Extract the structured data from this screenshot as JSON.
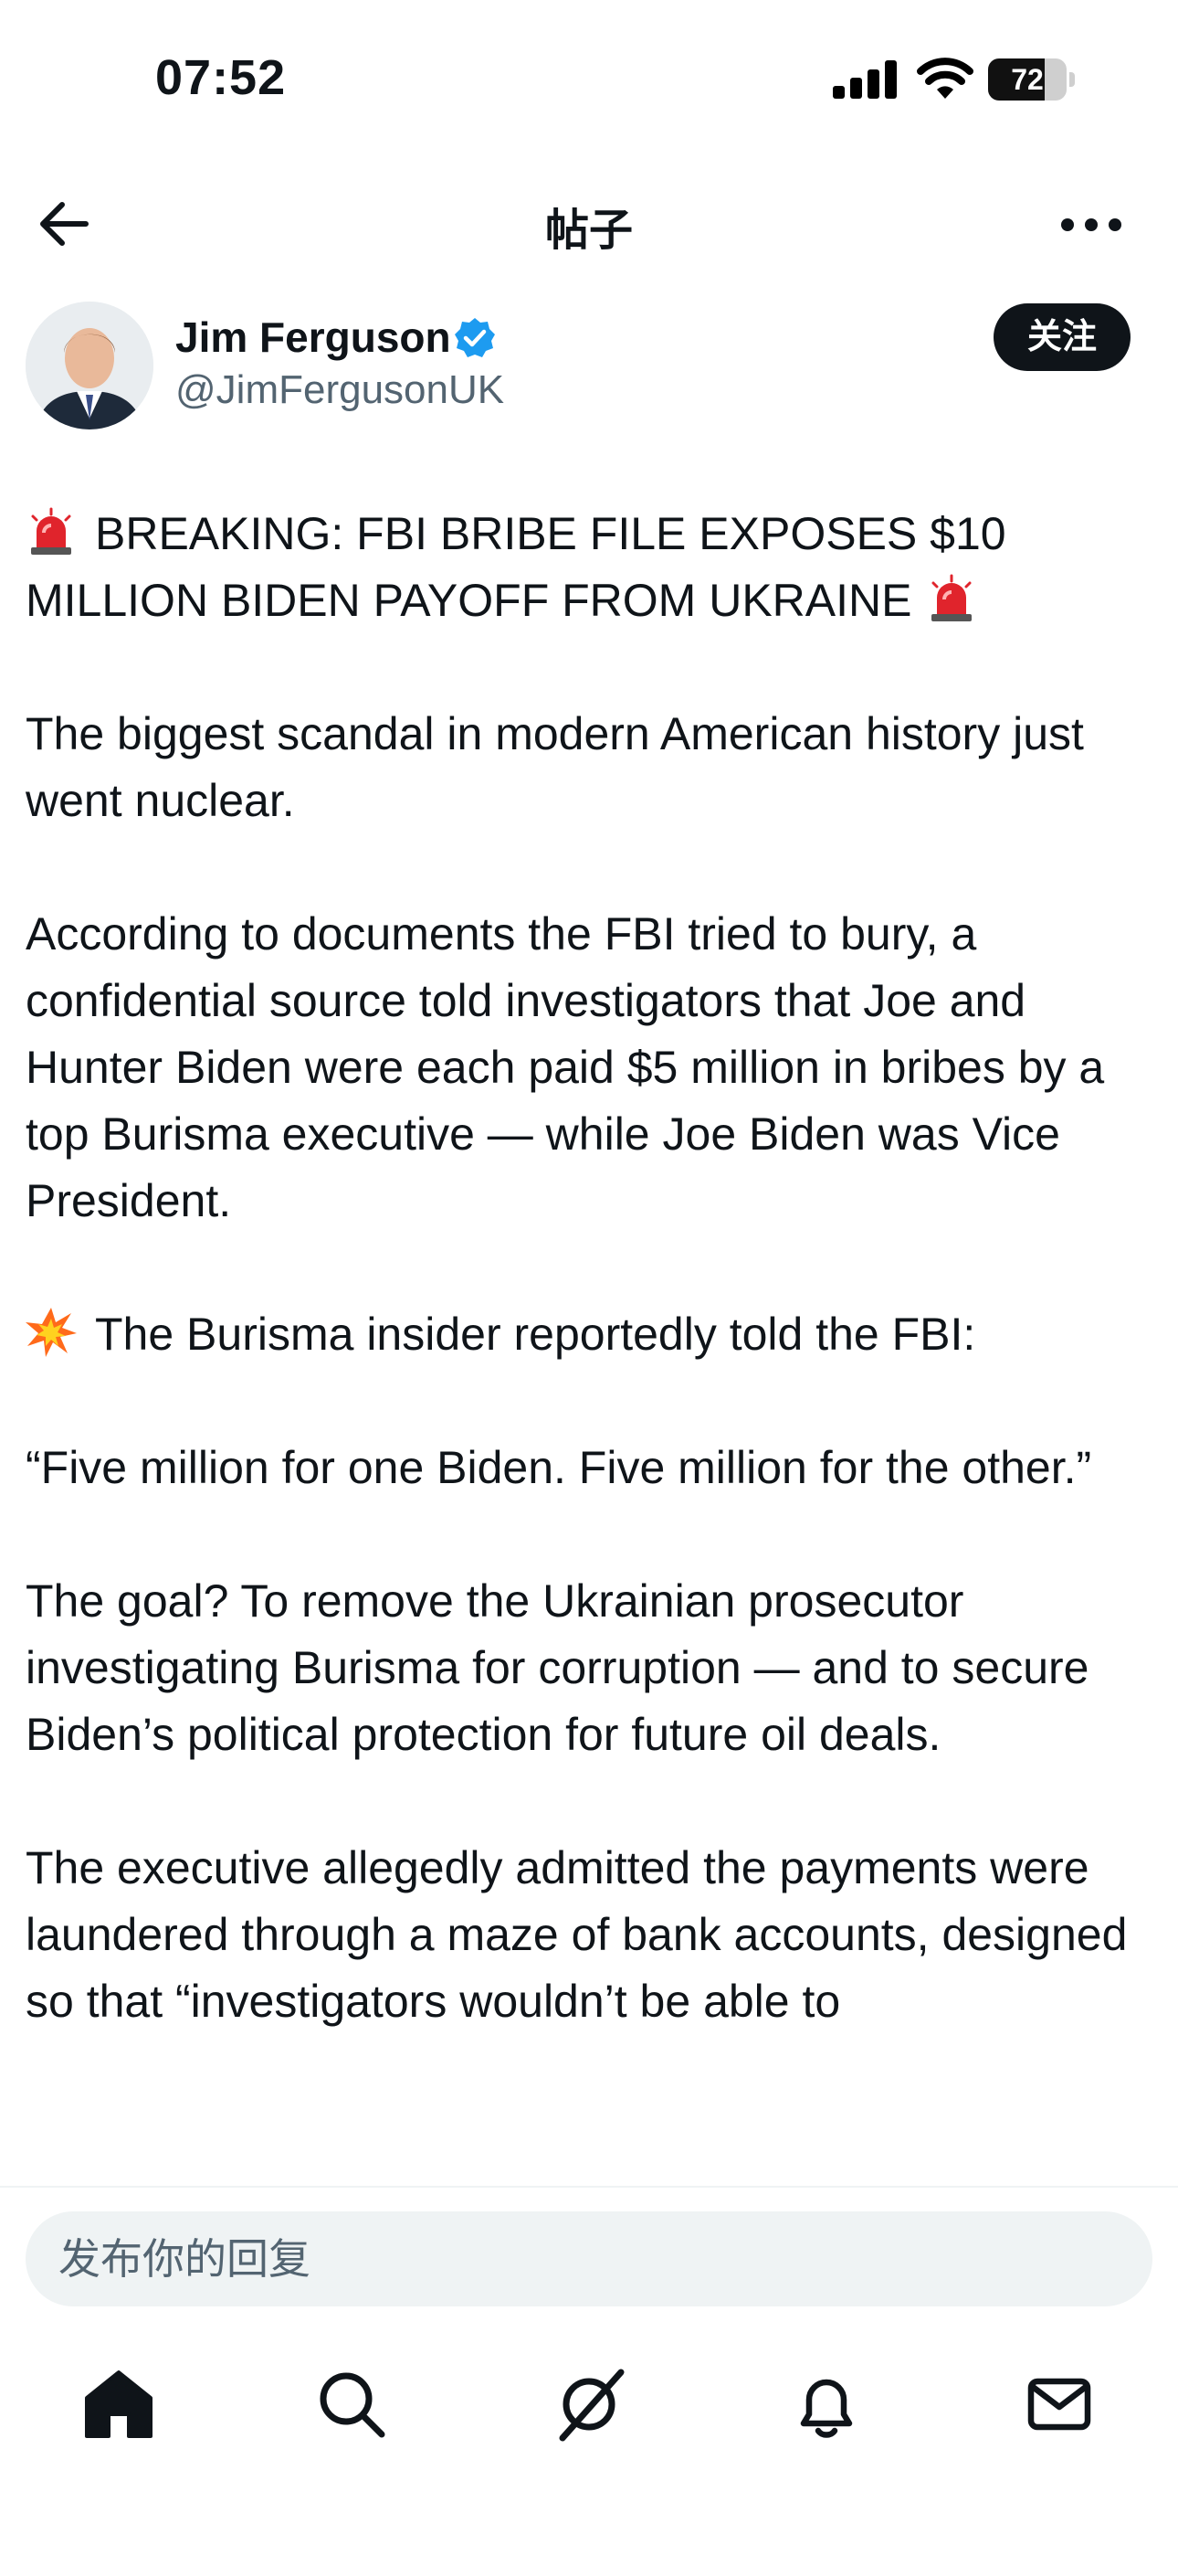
{
  "status_bar": {
    "time": "07:52",
    "battery_level": "72",
    "battery_fraction": 0.72
  },
  "nav": {
    "title": "帖子",
    "back_icon": "arrow-left-icon",
    "more_icon": "more-horizontal-icon"
  },
  "author": {
    "name": "Jim Ferguson",
    "handle": "@JimFergusonUK",
    "verified_color": "#1d9bf0",
    "follow_label": "关注"
  },
  "post": {
    "headline_prefix_icon": "police-light-icon",
    "headline": "BREAKING: FBI BRIBE FILE EXPOSES $10 MILLION BIDEN PAYOFF FROM UKRAINE",
    "headline_suffix_icon": "police-light-icon",
    "p1": "The biggest scandal in modern American history just went nuclear.",
    "p2": "According to documents the FBI tried to bury, a confidential source told investigators that Joe and Hunter Biden were each paid $5 million in bribes by a top Burisma executive — while Joe Biden was Vice President.",
    "p3_icon": "collision-icon",
    "p3": "The Burisma insider reportedly told the FBI:",
    "p4": "“Five million for one Biden. Five million for the other.”",
    "p5": "The goal? To remove the Ukrainian prosecutor investigating Burisma for corruption — and to secure Biden’s political protection for future oil deals.",
    "p6": "The executive allegedly admitted the payments were laundered through a maze of bank accounts, designed so that “investigators wouldn’t be able to"
  },
  "reply": {
    "placeholder": "发布你的回复"
  },
  "tab_bar": {
    "items": [
      "home-icon",
      "search-icon",
      "grok-icon",
      "notifications-icon",
      "messages-icon"
    ]
  },
  "colors": {
    "text": "#0f1419",
    "secondary": "#536471",
    "accent": "#1d9bf0",
    "alert_red": "#e0242c"
  }
}
